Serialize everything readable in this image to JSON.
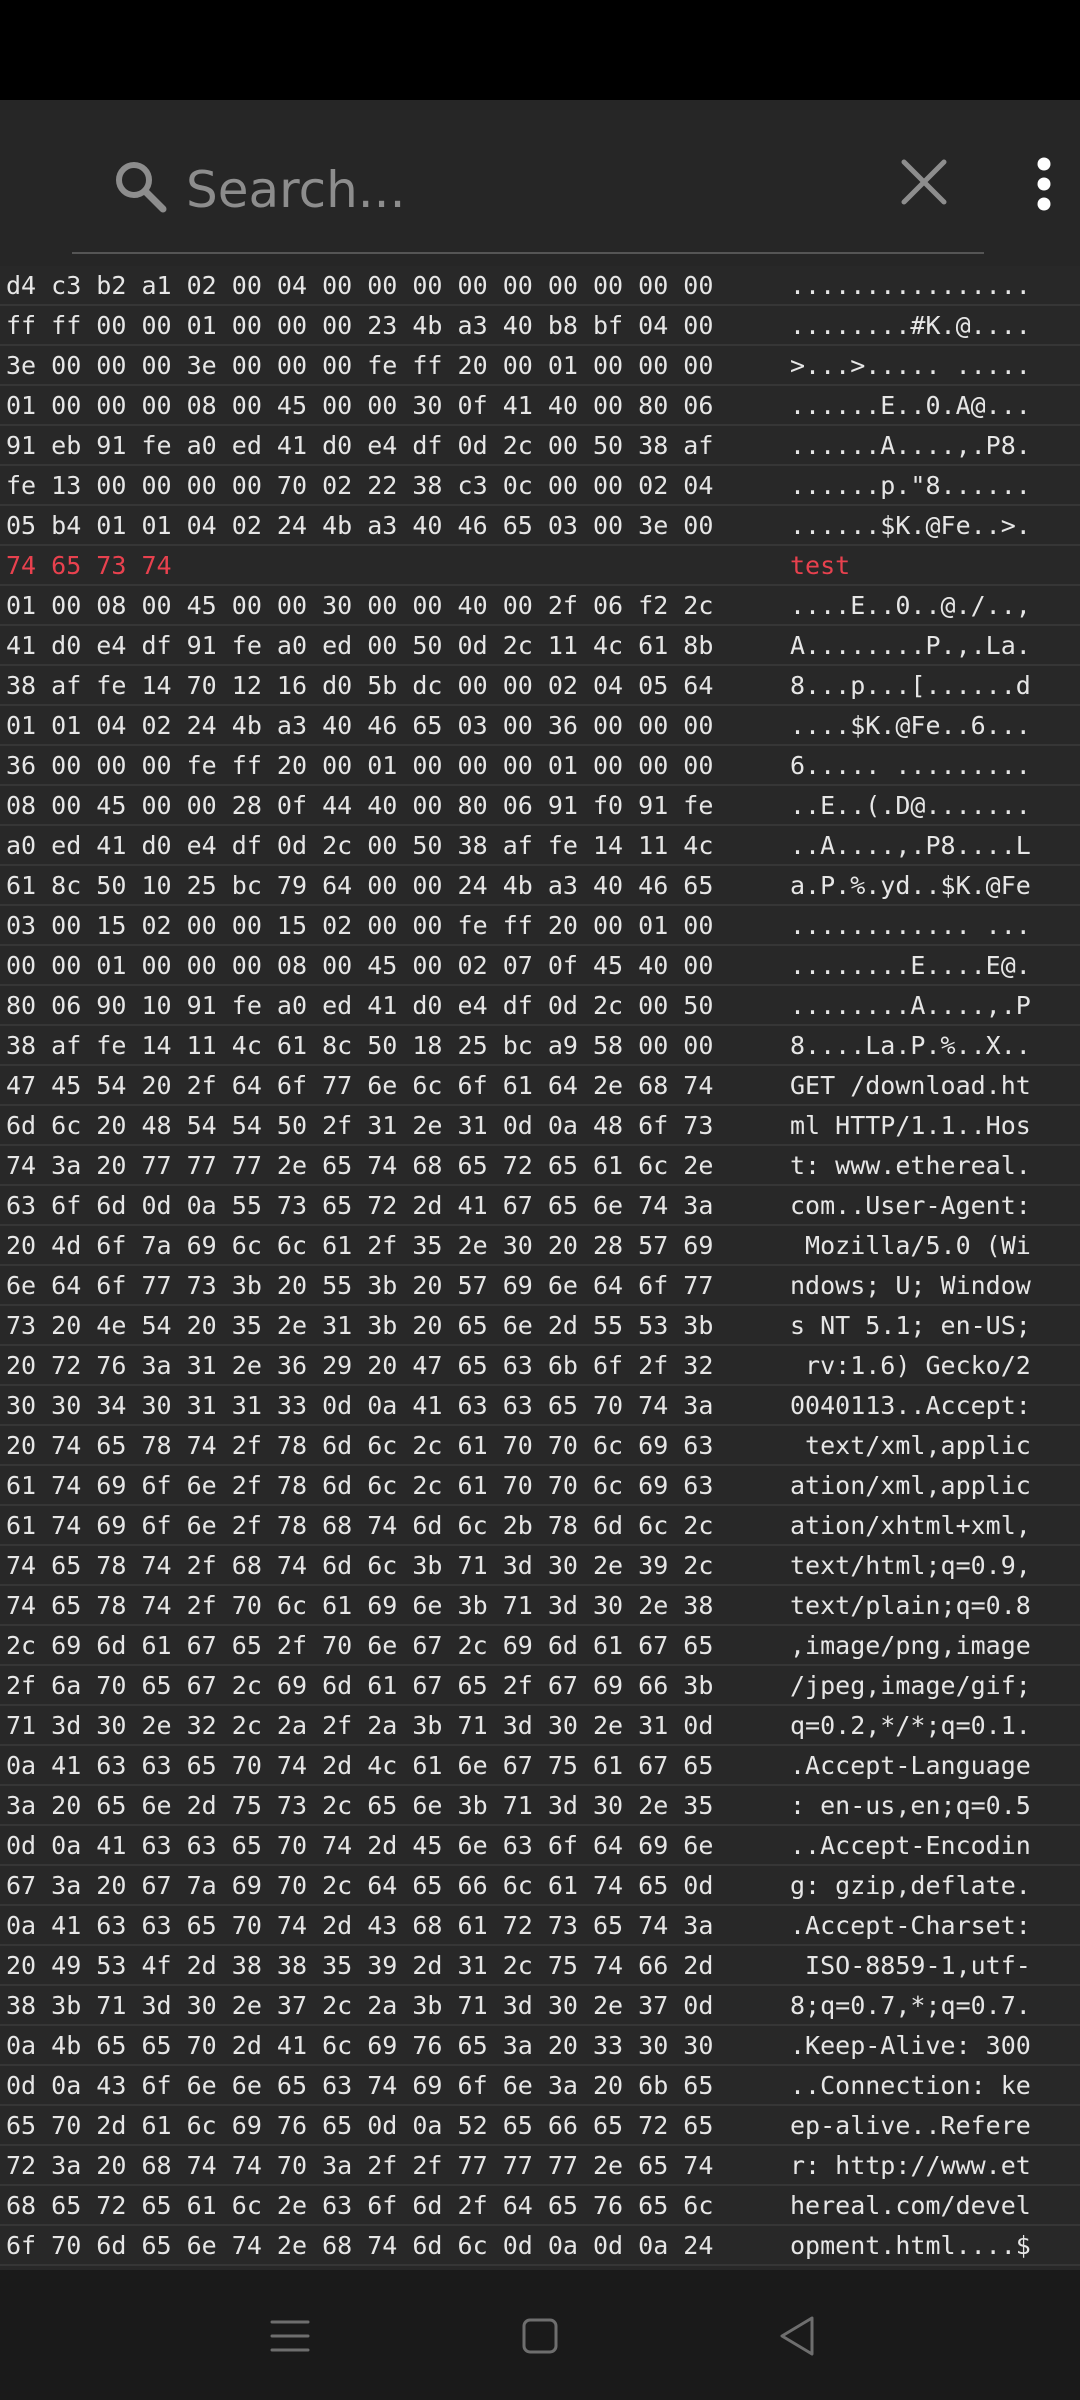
{
  "search": {
    "placeholder": "Search..."
  },
  "icons": {
    "search": "search-icon",
    "clear": "close-icon",
    "more": "more-vert-icon",
    "menu": "menu-icon",
    "home": "home-icon",
    "back": "back-icon"
  },
  "colors": {
    "text": "#e6e6e6",
    "highlight": "#e8414e",
    "background": "#282828",
    "toolbar": "#262626"
  },
  "rows": [
    {
      "hex": "d4 c3 b2 a1 02 00 04 00 00 00 00 00 00 00 00 00",
      "ascii": "................",
      "highlight": false
    },
    {
      "hex": "ff ff 00 00 01 00 00 00 23 4b a3 40 b8 bf 04 00",
      "ascii": "........#K.@....",
      "highlight": false
    },
    {
      "hex": "3e 00 00 00 3e 00 00 00 fe ff 20 00 01 00 00 00",
      "ascii": ">...>..... .....",
      "highlight": false
    },
    {
      "hex": "01 00 00 00 08 00 45 00 00 30 0f 41 40 00 80 06",
      "ascii": "......E..0.A@...",
      "highlight": false
    },
    {
      "hex": "91 eb 91 fe a0 ed 41 d0 e4 df 0d 2c 00 50 38 af",
      "ascii": "......A....,.P8.",
      "highlight": false
    },
    {
      "hex": "fe 13 00 00 00 00 70 02 22 38 c3 0c 00 00 02 04",
      "ascii": "......p.\"8......",
      "highlight": false
    },
    {
      "hex": "05 b4 01 01 04 02 24 4b a3 40 46 65 03 00 3e 00",
      "ascii": "......$K.@Fe..>.",
      "highlight": false
    },
    {
      "hex": "74 65 73 74",
      "ascii": "test",
      "highlight": true
    },
    {
      "hex": "01 00 08 00 45 00 00 30 00 00 40 00 2f 06 f2 2c",
      "ascii": "....E..0..@./..,",
      "highlight": false
    },
    {
      "hex": "41 d0 e4 df 91 fe a0 ed 00 50 0d 2c 11 4c 61 8b",
      "ascii": "A........P.,.La.",
      "highlight": false
    },
    {
      "hex": "38 af fe 14 70 12 16 d0 5b dc 00 00 02 04 05 64",
      "ascii": "8...p...[......d",
      "highlight": false
    },
    {
      "hex": "01 01 04 02 24 4b a3 40 46 65 03 00 36 00 00 00",
      "ascii": "....$K.@Fe..6...",
      "highlight": false
    },
    {
      "hex": "36 00 00 00 fe ff 20 00 01 00 00 00 01 00 00 00",
      "ascii": "6..... .........",
      "highlight": false
    },
    {
      "hex": "08 00 45 00 00 28 0f 44 40 00 80 06 91 f0 91 fe",
      "ascii": "..E..(.D@.......",
      "highlight": false
    },
    {
      "hex": "a0 ed 41 d0 e4 df 0d 2c 00 50 38 af fe 14 11 4c",
      "ascii": "..A....,.P8....L",
      "highlight": false
    },
    {
      "hex": "61 8c 50 10 25 bc 79 64 00 00 24 4b a3 40 46 65",
      "ascii": "a.P.%.yd..$K.@Fe",
      "highlight": false
    },
    {
      "hex": "03 00 15 02 00 00 15 02 00 00 fe ff 20 00 01 00",
      "ascii": "............ ...",
      "highlight": false
    },
    {
      "hex": "00 00 01 00 00 00 08 00 45 00 02 07 0f 45 40 00",
      "ascii": "........E....E@.",
      "highlight": false
    },
    {
      "hex": "80 06 90 10 91 fe a0 ed 41 d0 e4 df 0d 2c 00 50",
      "ascii": "........A....,.P",
      "highlight": false
    },
    {
      "hex": "38 af fe 14 11 4c 61 8c 50 18 25 bc a9 58 00 00",
      "ascii": "8....La.P.%..X..",
      "highlight": false
    },
    {
      "hex": "47 45 54 20 2f 64 6f 77 6e 6c 6f 61 64 2e 68 74",
      "ascii": "GET /download.ht",
      "highlight": false
    },
    {
      "hex": "6d 6c 20 48 54 54 50 2f 31 2e 31 0d 0a 48 6f 73",
      "ascii": "ml HTTP/1.1..Hos",
      "highlight": false
    },
    {
      "hex": "74 3a 20 77 77 77 2e 65 74 68 65 72 65 61 6c 2e",
      "ascii": "t: www.ethereal.",
      "highlight": false
    },
    {
      "hex": "63 6f 6d 0d 0a 55 73 65 72 2d 41 67 65 6e 74 3a",
      "ascii": "com..User-Agent:",
      "highlight": false
    },
    {
      "hex": "20 4d 6f 7a 69 6c 6c 61 2f 35 2e 30 20 28 57 69",
      "ascii": " Mozilla/5.0 (Wi",
      "highlight": false
    },
    {
      "hex": "6e 64 6f 77 73 3b 20 55 3b 20 57 69 6e 64 6f 77",
      "ascii": "ndows; U; Window",
      "highlight": false
    },
    {
      "hex": "73 20 4e 54 20 35 2e 31 3b 20 65 6e 2d 55 53 3b",
      "ascii": "s NT 5.1; en-US;",
      "highlight": false
    },
    {
      "hex": "20 72 76 3a 31 2e 36 29 20 47 65 63 6b 6f 2f 32",
      "ascii": " rv:1.6) Gecko/2",
      "highlight": false
    },
    {
      "hex": "30 30 34 30 31 31 33 0d 0a 41 63 63 65 70 74 3a",
      "ascii": "0040113..Accept:",
      "highlight": false
    },
    {
      "hex": "20 74 65 78 74 2f 78 6d 6c 2c 61 70 70 6c 69 63",
      "ascii": " text/xml,applic",
      "highlight": false
    },
    {
      "hex": "61 74 69 6f 6e 2f 78 6d 6c 2c 61 70 70 6c 69 63",
      "ascii": "ation/xml,applic",
      "highlight": false
    },
    {
      "hex": "61 74 69 6f 6e 2f 78 68 74 6d 6c 2b 78 6d 6c 2c",
      "ascii": "ation/xhtml+xml,",
      "highlight": false
    },
    {
      "hex": "74 65 78 74 2f 68 74 6d 6c 3b 71 3d 30 2e 39 2c",
      "ascii": "text/html;q=0.9,",
      "highlight": false
    },
    {
      "hex": "74 65 78 74 2f 70 6c 61 69 6e 3b 71 3d 30 2e 38",
      "ascii": "text/plain;q=0.8",
      "highlight": false
    },
    {
      "hex": "2c 69 6d 61 67 65 2f 70 6e 67 2c 69 6d 61 67 65",
      "ascii": ",image/png,image",
      "highlight": false
    },
    {
      "hex": "2f 6a 70 65 67 2c 69 6d 61 67 65 2f 67 69 66 3b",
      "ascii": "/jpeg,image/gif;",
      "highlight": false
    },
    {
      "hex": "71 3d 30 2e 32 2c 2a 2f 2a 3b 71 3d 30 2e 31 0d",
      "ascii": "q=0.2,*/*;q=0.1.",
      "highlight": false
    },
    {
      "hex": "0a 41 63 63 65 70 74 2d 4c 61 6e 67 75 61 67 65",
      "ascii": ".Accept-Language",
      "highlight": false
    },
    {
      "hex": "3a 20 65 6e 2d 75 73 2c 65 6e 3b 71 3d 30 2e 35",
      "ascii": ": en-us,en;q=0.5",
      "highlight": false
    },
    {
      "hex": "0d 0a 41 63 63 65 70 74 2d 45 6e 63 6f 64 69 6e",
      "ascii": "..Accept-Encodin",
      "highlight": false
    },
    {
      "hex": "67 3a 20 67 7a 69 70 2c 64 65 66 6c 61 74 65 0d",
      "ascii": "g: gzip,deflate.",
      "highlight": false
    },
    {
      "hex": "0a 41 63 63 65 70 74 2d 43 68 61 72 73 65 74 3a",
      "ascii": ".Accept-Charset:",
      "highlight": false
    },
    {
      "hex": "20 49 53 4f 2d 38 38 35 39 2d 31 2c 75 74 66 2d",
      "ascii": " ISO-8859-1,utf-",
      "highlight": false
    },
    {
      "hex": "38 3b 71 3d 30 2e 37 2c 2a 3b 71 3d 30 2e 37 0d",
      "ascii": "8;q=0.7,*;q=0.7.",
      "highlight": false
    },
    {
      "hex": "0a 4b 65 65 70 2d 41 6c 69 76 65 3a 20 33 30 30",
      "ascii": ".Keep-Alive: 300",
      "highlight": false
    },
    {
      "hex": "0d 0a 43 6f 6e 6e 65 63 74 69 6f 6e 3a 20 6b 65",
      "ascii": "..Connection: ke",
      "highlight": false
    },
    {
      "hex": "65 70 2d 61 6c 69 76 65 0d 0a 52 65 66 65 72 65",
      "ascii": "ep-alive..Refere",
      "highlight": false
    },
    {
      "hex": "72 3a 20 68 74 74 70 3a 2f 2f 77 77 77 2e 65 74",
      "ascii": "r: http://www.et",
      "highlight": false
    },
    {
      "hex": "68 65 72 65 61 6c 2e 63 6f 6d 2f 64 65 76 65 6c",
      "ascii": "hereal.com/devel",
      "highlight": false
    },
    {
      "hex": "6f 70 6d 65 6e 74 2e 68 74 6d 6c 0d 0a 0d 0a 24",
      "ascii": "opment.html....$",
      "highlight": false
    }
  ]
}
